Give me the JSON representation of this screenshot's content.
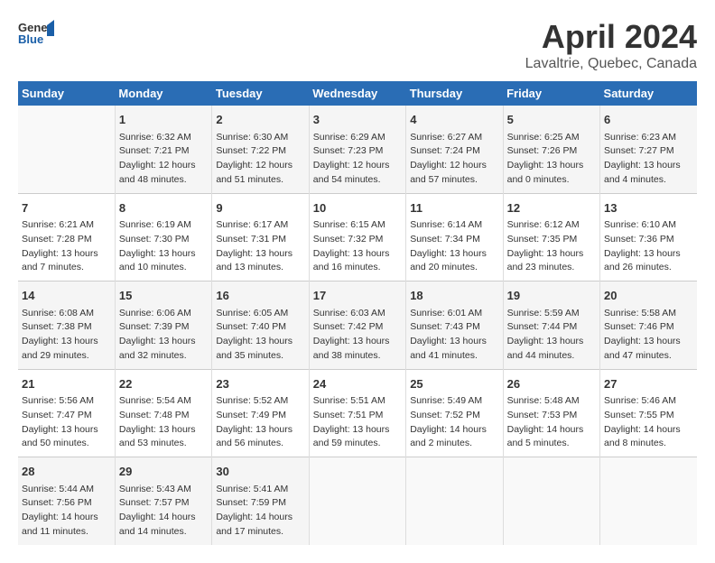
{
  "header": {
    "logo_general": "General",
    "logo_blue": "Blue",
    "title": "April 2024",
    "subtitle": "Lavaltrie, Quebec, Canada"
  },
  "calendar": {
    "days_of_week": [
      "Sunday",
      "Monday",
      "Tuesday",
      "Wednesday",
      "Thursday",
      "Friday",
      "Saturday"
    ],
    "weeks": [
      [
        {
          "day": "",
          "info": ""
        },
        {
          "day": "1",
          "info": "Sunrise: 6:32 AM\nSunset: 7:21 PM\nDaylight: 12 hours\nand 48 minutes."
        },
        {
          "day": "2",
          "info": "Sunrise: 6:30 AM\nSunset: 7:22 PM\nDaylight: 12 hours\nand 51 minutes."
        },
        {
          "day": "3",
          "info": "Sunrise: 6:29 AM\nSunset: 7:23 PM\nDaylight: 12 hours\nand 54 minutes."
        },
        {
          "day": "4",
          "info": "Sunrise: 6:27 AM\nSunset: 7:24 PM\nDaylight: 12 hours\nand 57 minutes."
        },
        {
          "day": "5",
          "info": "Sunrise: 6:25 AM\nSunset: 7:26 PM\nDaylight: 13 hours\nand 0 minutes."
        },
        {
          "day": "6",
          "info": "Sunrise: 6:23 AM\nSunset: 7:27 PM\nDaylight: 13 hours\nand 4 minutes."
        }
      ],
      [
        {
          "day": "7",
          "info": "Sunrise: 6:21 AM\nSunset: 7:28 PM\nDaylight: 13 hours\nand 7 minutes."
        },
        {
          "day": "8",
          "info": "Sunrise: 6:19 AM\nSunset: 7:30 PM\nDaylight: 13 hours\nand 10 minutes."
        },
        {
          "day": "9",
          "info": "Sunrise: 6:17 AM\nSunset: 7:31 PM\nDaylight: 13 hours\nand 13 minutes."
        },
        {
          "day": "10",
          "info": "Sunrise: 6:15 AM\nSunset: 7:32 PM\nDaylight: 13 hours\nand 16 minutes."
        },
        {
          "day": "11",
          "info": "Sunrise: 6:14 AM\nSunset: 7:34 PM\nDaylight: 13 hours\nand 20 minutes."
        },
        {
          "day": "12",
          "info": "Sunrise: 6:12 AM\nSunset: 7:35 PM\nDaylight: 13 hours\nand 23 minutes."
        },
        {
          "day": "13",
          "info": "Sunrise: 6:10 AM\nSunset: 7:36 PM\nDaylight: 13 hours\nand 26 minutes."
        }
      ],
      [
        {
          "day": "14",
          "info": "Sunrise: 6:08 AM\nSunset: 7:38 PM\nDaylight: 13 hours\nand 29 minutes."
        },
        {
          "day": "15",
          "info": "Sunrise: 6:06 AM\nSunset: 7:39 PM\nDaylight: 13 hours\nand 32 minutes."
        },
        {
          "day": "16",
          "info": "Sunrise: 6:05 AM\nSunset: 7:40 PM\nDaylight: 13 hours\nand 35 minutes."
        },
        {
          "day": "17",
          "info": "Sunrise: 6:03 AM\nSunset: 7:42 PM\nDaylight: 13 hours\nand 38 minutes."
        },
        {
          "day": "18",
          "info": "Sunrise: 6:01 AM\nSunset: 7:43 PM\nDaylight: 13 hours\nand 41 minutes."
        },
        {
          "day": "19",
          "info": "Sunrise: 5:59 AM\nSunset: 7:44 PM\nDaylight: 13 hours\nand 44 minutes."
        },
        {
          "day": "20",
          "info": "Sunrise: 5:58 AM\nSunset: 7:46 PM\nDaylight: 13 hours\nand 47 minutes."
        }
      ],
      [
        {
          "day": "21",
          "info": "Sunrise: 5:56 AM\nSunset: 7:47 PM\nDaylight: 13 hours\nand 50 minutes."
        },
        {
          "day": "22",
          "info": "Sunrise: 5:54 AM\nSunset: 7:48 PM\nDaylight: 13 hours\nand 53 minutes."
        },
        {
          "day": "23",
          "info": "Sunrise: 5:52 AM\nSunset: 7:49 PM\nDaylight: 13 hours\nand 56 minutes."
        },
        {
          "day": "24",
          "info": "Sunrise: 5:51 AM\nSunset: 7:51 PM\nDaylight: 13 hours\nand 59 minutes."
        },
        {
          "day": "25",
          "info": "Sunrise: 5:49 AM\nSunset: 7:52 PM\nDaylight: 14 hours\nand 2 minutes."
        },
        {
          "day": "26",
          "info": "Sunrise: 5:48 AM\nSunset: 7:53 PM\nDaylight: 14 hours\nand 5 minutes."
        },
        {
          "day": "27",
          "info": "Sunrise: 5:46 AM\nSunset: 7:55 PM\nDaylight: 14 hours\nand 8 minutes."
        }
      ],
      [
        {
          "day": "28",
          "info": "Sunrise: 5:44 AM\nSunset: 7:56 PM\nDaylight: 14 hours\nand 11 minutes."
        },
        {
          "day": "29",
          "info": "Sunrise: 5:43 AM\nSunset: 7:57 PM\nDaylight: 14 hours\nand 14 minutes."
        },
        {
          "day": "30",
          "info": "Sunrise: 5:41 AM\nSunset: 7:59 PM\nDaylight: 14 hours\nand 17 minutes."
        },
        {
          "day": "",
          "info": ""
        },
        {
          "day": "",
          "info": ""
        },
        {
          "day": "",
          "info": ""
        },
        {
          "day": "",
          "info": ""
        }
      ]
    ]
  }
}
